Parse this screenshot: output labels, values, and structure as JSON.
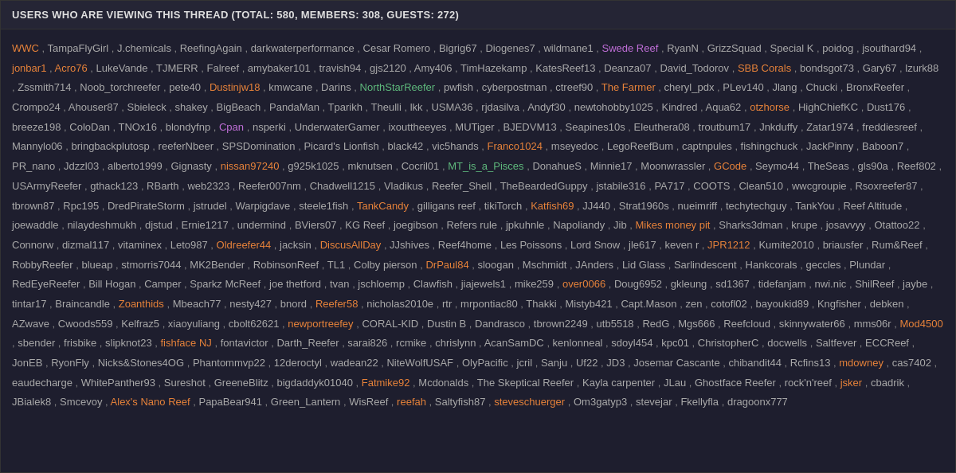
{
  "header": {
    "title": "USERS WHO ARE VIEWING THIS THREAD (TOTAL: 580, MEMBERS: 308, GUESTS: 272)"
  },
  "users": [
    {
      "name": "WWC",
      "color": "orange"
    },
    {
      "name": "TampaFlyGirl",
      "color": "normal"
    },
    {
      "name": "J.chemicals",
      "color": "normal"
    },
    {
      "name": "ReefingAgain",
      "color": "normal"
    },
    {
      "name": "darkwaterperformance",
      "color": "normal"
    },
    {
      "name": "Cesar Romero",
      "color": "normal"
    },
    {
      "name": "Bigrig67",
      "color": "normal"
    },
    {
      "name": "Diogenes7",
      "color": "normal"
    },
    {
      "name": "wildmane1",
      "color": "normal"
    },
    {
      "name": "Swede Reef",
      "color": "purple"
    },
    {
      "name": "RyanN",
      "color": "normal"
    },
    {
      "name": "GrizzSquad",
      "color": "normal"
    },
    {
      "name": "Special K",
      "color": "normal"
    },
    {
      "name": "poidog",
      "color": "normal"
    },
    {
      "name": "jsouthard94",
      "color": "normal"
    },
    {
      "name": "jonbar1",
      "color": "orange"
    },
    {
      "name": "Acro76",
      "color": "orange"
    },
    {
      "name": "LukeVande",
      "color": "normal"
    },
    {
      "name": "TJMERR",
      "color": "normal"
    },
    {
      "name": "Falreef",
      "color": "normal"
    },
    {
      "name": "amybaker101",
      "color": "normal"
    },
    {
      "name": "travish94",
      "color": "normal"
    },
    {
      "name": "gjs2120",
      "color": "normal"
    },
    {
      "name": "Amy406",
      "color": "normal"
    },
    {
      "name": "TimHazekamp",
      "color": "normal"
    },
    {
      "name": "KatesReef13",
      "color": "normal"
    },
    {
      "name": "Deanza07",
      "color": "normal"
    },
    {
      "name": "David_Todorov",
      "color": "normal"
    },
    {
      "name": "SBB Corals",
      "color": "orange"
    },
    {
      "name": "bondsgot73",
      "color": "normal"
    },
    {
      "name": "Gary67",
      "color": "normal"
    },
    {
      "name": "lzurk88",
      "color": "normal"
    },
    {
      "name": "Zssmith714",
      "color": "normal"
    },
    {
      "name": "Noob_torchreefer",
      "color": "normal"
    },
    {
      "name": "pete40",
      "color": "normal"
    },
    {
      "name": "Dustinjw18",
      "color": "orange"
    },
    {
      "name": "kmwcane",
      "color": "normal"
    },
    {
      "name": "Darins",
      "color": "normal"
    },
    {
      "name": "NorthStarReefer",
      "color": "green"
    },
    {
      "name": "pwfish",
      "color": "normal"
    },
    {
      "name": "cyberpostman",
      "color": "normal"
    },
    {
      "name": "ctreef90",
      "color": "normal"
    },
    {
      "name": "The Farmer",
      "color": "orange"
    },
    {
      "name": "cheryl_pdx",
      "color": "normal"
    },
    {
      "name": "PLev140",
      "color": "normal"
    },
    {
      "name": "Jlang",
      "color": "normal"
    },
    {
      "name": "Chucki",
      "color": "normal"
    },
    {
      "name": "BronxReefer",
      "color": "normal"
    },
    {
      "name": "Crompo24",
      "color": "normal"
    },
    {
      "name": "Ahouser87",
      "color": "normal"
    },
    {
      "name": "Sbieleck",
      "color": "normal"
    },
    {
      "name": "shakey",
      "color": "normal"
    },
    {
      "name": "BigBeach",
      "color": "normal"
    },
    {
      "name": "PandaMan",
      "color": "normal"
    },
    {
      "name": "Tparikh",
      "color": "normal"
    },
    {
      "name": "Theulli",
      "color": "normal"
    },
    {
      "name": "lkk",
      "color": "normal"
    },
    {
      "name": "USMA36",
      "color": "normal"
    },
    {
      "name": "rjdasilva",
      "color": "normal"
    },
    {
      "name": "Andyf30",
      "color": "normal"
    },
    {
      "name": "newtohobby1025",
      "color": "normal"
    },
    {
      "name": "Kindred",
      "color": "normal"
    },
    {
      "name": "Aqua62",
      "color": "normal"
    },
    {
      "name": "otzhorse",
      "color": "orange"
    },
    {
      "name": "HighChiefKC",
      "color": "normal"
    },
    {
      "name": "Dust176",
      "color": "normal"
    },
    {
      "name": "breeze198",
      "color": "normal"
    },
    {
      "name": "ColoDan",
      "color": "normal"
    },
    {
      "name": "TNOx16",
      "color": "normal"
    },
    {
      "name": "blondyfnp",
      "color": "normal"
    },
    {
      "name": "Cpan",
      "color": "purple"
    },
    {
      "name": "nsperki",
      "color": "normal"
    },
    {
      "name": "UnderwaterGamer",
      "color": "normal"
    },
    {
      "name": "ixouttheeyes",
      "color": "normal"
    },
    {
      "name": "MUTiger",
      "color": "normal"
    },
    {
      "name": "BJEDVM13",
      "color": "normal"
    },
    {
      "name": "Seapines10s",
      "color": "normal"
    },
    {
      "name": "Eleuthera08",
      "color": "normal"
    },
    {
      "name": "troutbum17",
      "color": "normal"
    },
    {
      "name": "Jnkduffy",
      "color": "normal"
    },
    {
      "name": "Zatar1974",
      "color": "normal"
    },
    {
      "name": "freddiesreef",
      "color": "normal"
    },
    {
      "name": "Mannylo06",
      "color": "normal"
    },
    {
      "name": "bringbackplutosp",
      "color": "normal"
    },
    {
      "name": "reeferNbeer",
      "color": "normal"
    },
    {
      "name": "SPSDomination",
      "color": "normal"
    },
    {
      "name": "Picard's Lionfish",
      "color": "normal"
    },
    {
      "name": "black42",
      "color": "normal"
    },
    {
      "name": "vic5hands",
      "color": "normal"
    },
    {
      "name": "Franco1024",
      "color": "orange"
    },
    {
      "name": "mseyedoc",
      "color": "normal"
    },
    {
      "name": "LegoReefBum",
      "color": "normal"
    },
    {
      "name": "captnpules",
      "color": "normal"
    },
    {
      "name": "fishingchuck",
      "color": "normal"
    },
    {
      "name": "JackPinny",
      "color": "normal"
    },
    {
      "name": "Baboon7",
      "color": "normal"
    },
    {
      "name": "PR_nano",
      "color": "normal"
    },
    {
      "name": "Jdzzl03",
      "color": "normal"
    },
    {
      "name": "alberto1999",
      "color": "normal"
    },
    {
      "name": "Gignasty",
      "color": "normal"
    },
    {
      "name": "nissan97240",
      "color": "orange"
    },
    {
      "name": "g925k1025",
      "color": "normal"
    },
    {
      "name": "mknutsen",
      "color": "normal"
    },
    {
      "name": "Cocril01",
      "color": "normal"
    },
    {
      "name": "MT_is_a_Pisces",
      "color": "green"
    },
    {
      "name": "DonahueS",
      "color": "normal"
    },
    {
      "name": "Minnie17",
      "color": "normal"
    },
    {
      "name": "Moonwrassler",
      "color": "normal"
    },
    {
      "name": "GCode",
      "color": "orange"
    },
    {
      "name": "Seymo44",
      "color": "normal"
    },
    {
      "name": "TheSeas",
      "color": "normal"
    },
    {
      "name": "gls90a",
      "color": "normal"
    },
    {
      "name": "Reef802",
      "color": "normal"
    },
    {
      "name": "USArmyReefer",
      "color": "normal"
    },
    {
      "name": "gthack123",
      "color": "normal"
    },
    {
      "name": "RBarth",
      "color": "normal"
    },
    {
      "name": "web2323",
      "color": "normal"
    },
    {
      "name": "Reefer007nm",
      "color": "normal"
    },
    {
      "name": "Chadwell1215",
      "color": "normal"
    },
    {
      "name": "Vladikus",
      "color": "normal"
    },
    {
      "name": "Reefer_Shell",
      "color": "normal"
    },
    {
      "name": "TheBeardedGuppy",
      "color": "normal"
    },
    {
      "name": "jstabile316",
      "color": "normal"
    },
    {
      "name": "PA717",
      "color": "normal"
    },
    {
      "name": "COOTS",
      "color": "normal"
    },
    {
      "name": "Clean510",
      "color": "normal"
    },
    {
      "name": "wwcgroupie",
      "color": "normal"
    },
    {
      "name": "Rsoxreefer87",
      "color": "normal"
    },
    {
      "name": "tbrown87",
      "color": "normal"
    },
    {
      "name": "Rpc195",
      "color": "normal"
    },
    {
      "name": "DredPirateStorm",
      "color": "normal"
    },
    {
      "name": "jstrudel",
      "color": "normal"
    },
    {
      "name": "Warpigdave",
      "color": "normal"
    },
    {
      "name": "steele1fish",
      "color": "normal"
    },
    {
      "name": "TankCandy",
      "color": "orange"
    },
    {
      "name": "gilligans reef",
      "color": "normal"
    },
    {
      "name": "tikiTorch",
      "color": "normal"
    },
    {
      "name": "Katfish69",
      "color": "orange"
    },
    {
      "name": "JJ440",
      "color": "normal"
    },
    {
      "name": "Strat1960s",
      "color": "normal"
    },
    {
      "name": "nueimriff",
      "color": "normal"
    },
    {
      "name": "techytechguy",
      "color": "normal"
    },
    {
      "name": "TankYou",
      "color": "normal"
    },
    {
      "name": "Reef Altitude",
      "color": "normal"
    },
    {
      "name": "joewaddle",
      "color": "normal"
    },
    {
      "name": "nilaydeshmukh",
      "color": "normal"
    },
    {
      "name": "djstud",
      "color": "normal"
    },
    {
      "name": "Ernie1217",
      "color": "normal"
    },
    {
      "name": "undermind",
      "color": "normal"
    },
    {
      "name": "BViers07",
      "color": "normal"
    },
    {
      "name": "KG Reef",
      "color": "normal"
    },
    {
      "name": "joegibson",
      "color": "normal"
    },
    {
      "name": "Refers rule",
      "color": "normal"
    },
    {
      "name": "jpkuhnle",
      "color": "normal"
    },
    {
      "name": "Napoliandy",
      "color": "normal"
    },
    {
      "name": "Jib",
      "color": "normal"
    },
    {
      "name": "Mikes money pit",
      "color": "orange"
    },
    {
      "name": "Sharks3dman",
      "color": "normal"
    },
    {
      "name": "krupe",
      "color": "normal"
    },
    {
      "name": "josavvyy",
      "color": "normal"
    },
    {
      "name": "Otattoo22",
      "color": "normal"
    },
    {
      "name": "Connorw",
      "color": "normal"
    },
    {
      "name": "dizmal117",
      "color": "normal"
    },
    {
      "name": "vitaminex",
      "color": "normal"
    },
    {
      "name": "Leto987",
      "color": "normal"
    },
    {
      "name": "Oldreefer44",
      "color": "orange"
    },
    {
      "name": "jacksin",
      "color": "normal"
    },
    {
      "name": "DiscusAllDay",
      "color": "orange"
    },
    {
      "name": "JJshives",
      "color": "normal"
    },
    {
      "name": "Reef4home",
      "color": "normal"
    },
    {
      "name": "Les Poissons",
      "color": "normal"
    },
    {
      "name": "Lord Snow",
      "color": "normal"
    },
    {
      "name": "jle617",
      "color": "normal"
    },
    {
      "name": "keven r",
      "color": "normal"
    },
    {
      "name": "JPR1212",
      "color": "orange"
    },
    {
      "name": "Kumite2010",
      "color": "normal"
    },
    {
      "name": "briausfer",
      "color": "normal"
    },
    {
      "name": "Rum&Reef",
      "color": "normal"
    },
    {
      "name": "RobbyReefer",
      "color": "normal"
    },
    {
      "name": "blueap",
      "color": "normal"
    },
    {
      "name": "stmorris7044",
      "color": "normal"
    },
    {
      "name": "MK2Bender",
      "color": "normal"
    },
    {
      "name": "RobinsonReef",
      "color": "normal"
    },
    {
      "name": "TL1",
      "color": "normal"
    },
    {
      "name": "Colby pierson",
      "color": "normal"
    },
    {
      "name": "DrPaul84",
      "color": "orange"
    },
    {
      "name": "sloogan",
      "color": "normal"
    },
    {
      "name": "Mschmidt",
      "color": "normal"
    },
    {
      "name": "JAnders",
      "color": "normal"
    },
    {
      "name": "Lid Glass",
      "color": "normal"
    },
    {
      "name": "Sarlindescent",
      "color": "normal"
    },
    {
      "name": "Hankcorals",
      "color": "normal"
    },
    {
      "name": "geccles",
      "color": "normal"
    },
    {
      "name": "Plundar",
      "color": "normal"
    },
    {
      "name": "RedEyeReefer",
      "color": "normal"
    },
    {
      "name": "Bill Hogan",
      "color": "normal"
    },
    {
      "name": "Camper",
      "color": "normal"
    },
    {
      "name": "Sparkz McReef",
      "color": "normal"
    },
    {
      "name": "joe thetford",
      "color": "normal"
    },
    {
      "name": "tvan",
      "color": "normal"
    },
    {
      "name": "jschloemp",
      "color": "normal"
    },
    {
      "name": "Clawfish",
      "color": "normal"
    },
    {
      "name": "jiajewels1",
      "color": "normal"
    },
    {
      "name": "mike259",
      "color": "normal"
    },
    {
      "name": "over0066",
      "color": "orange"
    },
    {
      "name": "Doug6952",
      "color": "normal"
    },
    {
      "name": "gkleung",
      "color": "normal"
    },
    {
      "name": "sd1367",
      "color": "normal"
    },
    {
      "name": "tidefanjam",
      "color": "normal"
    },
    {
      "name": "nwi.nic",
      "color": "normal"
    },
    {
      "name": "ShilReef",
      "color": "normal"
    },
    {
      "name": "jaybe",
      "color": "normal"
    },
    {
      "name": "tintar17",
      "color": "normal"
    },
    {
      "name": "Braincandle",
      "color": "normal"
    },
    {
      "name": "Zoanthids",
      "color": "orange"
    },
    {
      "name": "Mbeach77",
      "color": "normal"
    },
    {
      "name": "nesty427",
      "color": "normal"
    },
    {
      "name": "bnord",
      "color": "normal"
    },
    {
      "name": "Reefer58",
      "color": "orange"
    },
    {
      "name": "nicholas2010e",
      "color": "normal"
    },
    {
      "name": "rtr",
      "color": "normal"
    },
    {
      "name": "mrpontiac80",
      "color": "normal"
    },
    {
      "name": "Thakki",
      "color": "normal"
    },
    {
      "name": "Mistyb421",
      "color": "normal"
    },
    {
      "name": "Capt.Mason",
      "color": "normal"
    },
    {
      "name": "zen",
      "color": "normal"
    },
    {
      "name": "cotofl02",
      "color": "normal"
    },
    {
      "name": "bayoukid89",
      "color": "normal"
    },
    {
      "name": "Kngfisher",
      "color": "normal"
    },
    {
      "name": "debken",
      "color": "normal"
    },
    {
      "name": "AZwave",
      "color": "normal"
    },
    {
      "name": "Cwoods559",
      "color": "normal"
    },
    {
      "name": "Kelfraz5",
      "color": "normal"
    },
    {
      "name": "xiaoyuliang",
      "color": "normal"
    },
    {
      "name": "cbolt62621",
      "color": "normal"
    },
    {
      "name": "newportreefey",
      "color": "orange"
    },
    {
      "name": "CORAL-KID",
      "color": "normal"
    },
    {
      "name": "Dustin B",
      "color": "normal"
    },
    {
      "name": "Dandrasco",
      "color": "normal"
    },
    {
      "name": "tbrown2249",
      "color": "normal"
    },
    {
      "name": "utb5518",
      "color": "normal"
    },
    {
      "name": "RedG",
      "color": "normal"
    },
    {
      "name": "Mgs666",
      "color": "normal"
    },
    {
      "name": "Reefcloud",
      "color": "normal"
    },
    {
      "name": "skinnywater66",
      "color": "normal"
    },
    {
      "name": "mms06r",
      "color": "normal"
    },
    {
      "name": "Mod4500",
      "color": "orange"
    },
    {
      "name": "sbender",
      "color": "normal"
    },
    {
      "name": "frisbike",
      "color": "normal"
    },
    {
      "name": "slipknot23",
      "color": "normal"
    },
    {
      "name": "fishface NJ",
      "color": "orange"
    },
    {
      "name": "fontavictor",
      "color": "normal"
    },
    {
      "name": "Darth_Reefer",
      "color": "normal"
    },
    {
      "name": "sarai826",
      "color": "normal"
    },
    {
      "name": "rcmike",
      "color": "normal"
    },
    {
      "name": "chrislynn",
      "color": "normal"
    },
    {
      "name": "AcanSamDC",
      "color": "normal"
    },
    {
      "name": "kenlonneal",
      "color": "normal"
    },
    {
      "name": "sdoyl454",
      "color": "normal"
    },
    {
      "name": "kpc01",
      "color": "normal"
    },
    {
      "name": "ChristopherC",
      "color": "normal"
    },
    {
      "name": "docwells",
      "color": "normal"
    },
    {
      "name": "Saltfever",
      "color": "normal"
    },
    {
      "name": "ECCReef",
      "color": "normal"
    },
    {
      "name": "JonEB",
      "color": "normal"
    },
    {
      "name": "RyonFly",
      "color": "normal"
    },
    {
      "name": "Nicks&Stones4OG",
      "color": "normal"
    },
    {
      "name": "Phantommvp22",
      "color": "normal"
    },
    {
      "name": "12deroctyl",
      "color": "normal"
    },
    {
      "name": "wadean22",
      "color": "normal"
    },
    {
      "name": "NiteWolfUSAF",
      "color": "normal"
    },
    {
      "name": "OlyPacific",
      "color": "normal"
    },
    {
      "name": "jcril",
      "color": "normal"
    },
    {
      "name": "Sanju",
      "color": "normal"
    },
    {
      "name": "Uf22",
      "color": "normal"
    },
    {
      "name": "JD3",
      "color": "normal"
    },
    {
      "name": "Josemar Cascante",
      "color": "normal"
    },
    {
      "name": "chibandit44",
      "color": "normal"
    },
    {
      "name": "Rcfins13",
      "color": "normal"
    },
    {
      "name": "mdowney",
      "color": "orange"
    },
    {
      "name": "cas7402",
      "color": "normal"
    },
    {
      "name": "eaudecharge",
      "color": "normal"
    },
    {
      "name": "WhitePanther93",
      "color": "normal"
    },
    {
      "name": "Sureshot",
      "color": "normal"
    },
    {
      "name": "GreeneBlitz",
      "color": "normal"
    },
    {
      "name": "bigdaddyk01040",
      "color": "normal"
    },
    {
      "name": "Fatmike92",
      "color": "orange"
    },
    {
      "name": "Mcdonalds",
      "color": "normal"
    },
    {
      "name": "The Skeptical Reefer",
      "color": "normal"
    },
    {
      "name": "Kayla carpenter",
      "color": "normal"
    },
    {
      "name": "JLau",
      "color": "normal"
    },
    {
      "name": "Ghostface Reefer",
      "color": "normal"
    },
    {
      "name": "rock'n'reef",
      "color": "normal"
    },
    {
      "name": "jsker",
      "color": "orange"
    },
    {
      "name": "cbadrik",
      "color": "normal"
    },
    {
      "name": "JBialek8",
      "color": "normal"
    },
    {
      "name": "Smcevoy",
      "color": "normal"
    },
    {
      "name": "Alex's Nano Reef",
      "color": "orange"
    },
    {
      "name": "PapaBear941",
      "color": "normal"
    },
    {
      "name": "Green_Lantern",
      "color": "normal"
    },
    {
      "name": "WisReef",
      "color": "normal"
    },
    {
      "name": "reefah",
      "color": "orange"
    },
    {
      "name": "Saltyfish87",
      "color": "normal"
    },
    {
      "name": "steveschuerger",
      "color": "orange"
    },
    {
      "name": "Om3gatyp3",
      "color": "normal"
    },
    {
      "name": "stevejar",
      "color": "normal"
    },
    {
      "name": "Fkellyfla",
      "color": "normal"
    },
    {
      "name": "dragoonx777",
      "color": "normal"
    }
  ]
}
